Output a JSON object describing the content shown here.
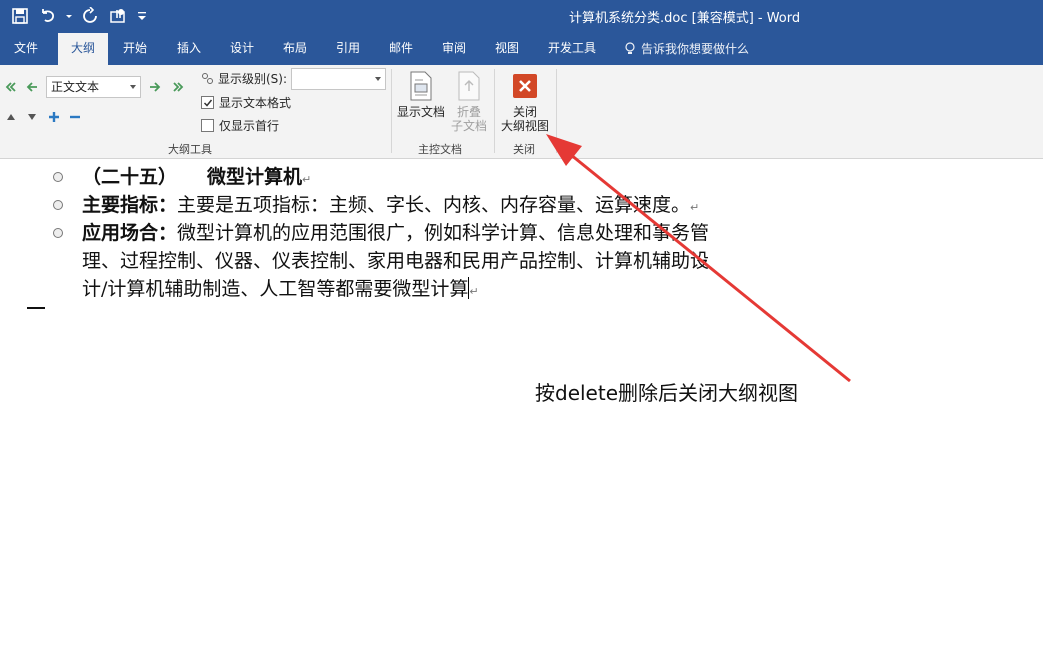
{
  "window": {
    "title": "计算机系统分类.doc [兼容模式] - Word"
  },
  "qat": {
    "save_icon": "save-icon",
    "undo_icon": "undo-icon",
    "redo_icon": "redo-icon",
    "touch_icon": "touch-mode-icon",
    "customize_icon": "customize-icon"
  },
  "tabs": [
    {
      "label": "文件"
    },
    {
      "label": "大纲"
    },
    {
      "label": "开始"
    },
    {
      "label": "插入"
    },
    {
      "label": "设计"
    },
    {
      "label": "布局"
    },
    {
      "label": "引用"
    },
    {
      "label": "邮件"
    },
    {
      "label": "审阅"
    },
    {
      "label": "视图"
    },
    {
      "label": "开发工具"
    }
  ],
  "tell_me": "告诉我你想要做什么",
  "ribbon": {
    "outline_tools": {
      "level_value": "正文文本",
      "show_level_label": "显示级别(S):",
      "show_format_label": "显示文本格式",
      "show_format_checked": true,
      "first_line_label": "仅显示首行",
      "first_line_checked": false,
      "group_label": "大纲工具"
    },
    "master": {
      "show_doc": "显示文档",
      "collapse_line1": "折叠",
      "collapse_line2": "子文档",
      "group_label": "主控文档"
    },
    "close": {
      "line1": "关闭",
      "line2": "大纲视图",
      "group_label": "关闭"
    }
  },
  "colors": {
    "brand": "#2b579a",
    "close_red": "#d24726",
    "arrow_red": "#e53935"
  },
  "document": {
    "p1_title_a": "（二十五）",
    "p1_title_b": "微型计算机",
    "p2_bold": "主要指标：",
    "p2_text": "主要是五项指标：主频、字长、内核、内存容量、运算速度。",
    "p3_bold": "应用场合：",
    "p3_line1": "微型计算机的应用范围很广，例如科学计算、信息处理和事务管",
    "p3_line2": "理、过程控制、仪器、仪表控制、家用电器和民用产品控制、计算机辅助设",
    "p3_line3": "计/计算机辅助制造、人工智等都需要微型计算",
    "para_mark": "↵"
  },
  "annotation": "按delete删除后关闭大纲视图"
}
